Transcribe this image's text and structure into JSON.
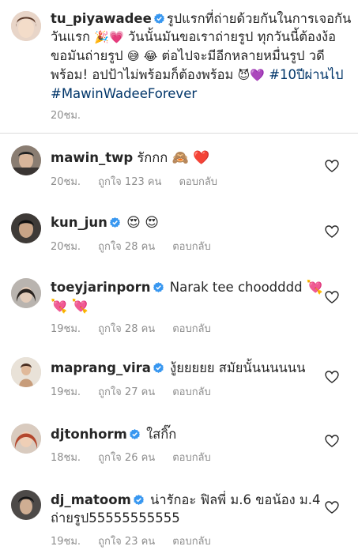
{
  "caption": {
    "username": "tu_piyawadee",
    "line1": "รูปแรกที่ถ่ายด้วยกันในการเจอกัน",
    "line2a": "วันแรก",
    "emoji_party": "🎉",
    "emoji_heart": "💗",
    "line2b": "วันนั้นมันขอเราถ่ายรูป ทุกวันนี้ต้องง้อ",
    "line3a": "ขอมันถ่ายรูป",
    "emoji_laugh1": "😅",
    "emoji_laugh2": "😂",
    "line3b": "ต่อไปจะมีอีกหลายหมื่นรูป วดี",
    "line4a": "พร้อม! อปป้าไม่พร้อมก็ต้องพร้อม",
    "emoji_devil": "😈",
    "emoji_purple": "💜",
    "hashtag1": "#10ปีผ่านไป",
    "hashtag2": "#MawinWadeeForever",
    "time": "20ชม."
  },
  "comments": [
    {
      "username": "mawin_twp",
      "verified": false,
      "text": "รักกก",
      "emoji": "🙈 ❤️",
      "time": "20ชม.",
      "likes": "ถูกใจ 123 คน",
      "reply": "ตอบกลับ"
    },
    {
      "username": "kun_jun",
      "verified": true,
      "text": "",
      "emoji": "😍 😍",
      "time": "20ชม.",
      "likes": "ถูกใจ 28 คน",
      "reply": "ตอบกลับ"
    },
    {
      "username": "toeyjarinporn",
      "verified": true,
      "text": "Narak tee choodddd",
      "emoji": "💘",
      "emoji2": "💘 💘",
      "time": "19ชม.",
      "likes": "ถูกใจ 28 คน",
      "reply": "ตอบกลับ"
    },
    {
      "username": "maprang_vira",
      "verified": true,
      "text": "งู้ยยยยย สมัยนั้นนนนนน",
      "emoji": "",
      "time": "19ชม.",
      "likes": "ถูกใจ 27 คน",
      "reply": "ตอบกลับ"
    },
    {
      "username": "djtonhorm",
      "verified": true,
      "text": "ใสกิ๊ก",
      "emoji": "",
      "time": "18ชม.",
      "likes": "ถูกใจ 26 คน",
      "reply": "ตอบกลับ"
    },
    {
      "username": "dj_matoom",
      "verified": true,
      "text": "น่ารักอะ ฟิลพี่ ม.6 ขอน้อง ม.4",
      "text2": "ถ่ายรูป55555555555",
      "emoji": "",
      "time": "19ชม.",
      "likes": "ถูกใจ 23 คน",
      "reply": "ตอบกลับ"
    }
  ],
  "icons": {
    "heart_outline": "heart-outline-icon",
    "verified": "verified-badge-icon"
  },
  "colors": {
    "text": "#262626",
    "meta": "#8e8e8e",
    "hashtag": "#003569",
    "verified": "#3897f0"
  }
}
